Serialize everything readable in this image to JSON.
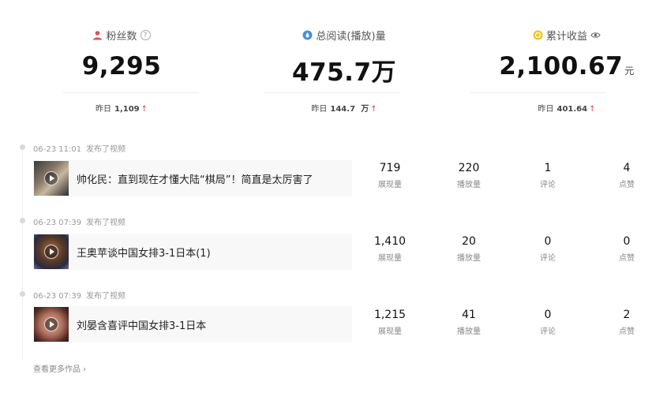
{
  "stats": [
    {
      "label": "粉丝数",
      "value": "9,295",
      "unit": "",
      "sub_label": "昨日",
      "sub_value": "1,109",
      "sub_unit": "",
      "trend": "↑",
      "icon": "user-icon"
    },
    {
      "label": "总阅读(播放)量",
      "value": "475.7万",
      "unit": "",
      "sub_label": "昨日",
      "sub_value": "144.7",
      "sub_unit": "万",
      "trend": "↑",
      "icon": "droplet-icon"
    },
    {
      "label": "累计收益",
      "value": "2,100.67",
      "unit": "元",
      "sub_label": "昨日",
      "sub_value": "401.64",
      "sub_unit": "",
      "trend": "↑",
      "icon": "coin-icon"
    }
  ],
  "help_glyph": "?",
  "posts": [
    {
      "time": "06-23 11:01",
      "action": "发布了视频",
      "title": "帅化民：直到现在才懂大陆“棋局”！简直是太厉害了",
      "metrics": [
        {
          "value": "719",
          "label": "展现量"
        },
        {
          "value": "220",
          "label": "播放量"
        },
        {
          "value": "1",
          "label": "评论"
        },
        {
          "value": "4",
          "label": "点赞"
        }
      ]
    },
    {
      "time": "06-23 07:39",
      "action": "发布了视频",
      "title": "王奥苹谈中国女排3-1日本(1)",
      "metrics": [
        {
          "value": "1,410",
          "label": "展现量"
        },
        {
          "value": "20",
          "label": "播放量"
        },
        {
          "value": "0",
          "label": "评论"
        },
        {
          "value": "0",
          "label": "点赞"
        }
      ]
    },
    {
      "time": "06-23 07:39",
      "action": "发布了视频",
      "title": "刘晏含喜评中国女排3-1日本",
      "metrics": [
        {
          "value": "1,215",
          "label": "展现量"
        },
        {
          "value": "41",
          "label": "播放量"
        },
        {
          "value": "0",
          "label": "评论"
        },
        {
          "value": "2",
          "label": "点赞"
        }
      ]
    }
  ],
  "more_link": "查看更多作品",
  "more_chevron": "›",
  "colors": {
    "trend_up": "#e04040",
    "accent_user": "#d9534f",
    "accent_drop": "#4a8fd9",
    "accent_coin": "#f0c419"
  }
}
